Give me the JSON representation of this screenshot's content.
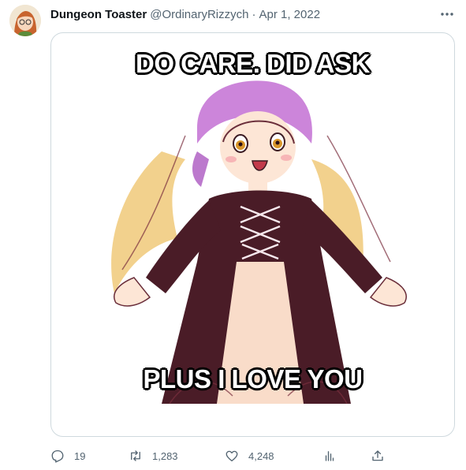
{
  "tweet": {
    "author": {
      "display_name": "Dungeon Toaster",
      "handle": "@OrdinaryRizzych",
      "separator": "·",
      "date": "Apr 1, 2022"
    },
    "media": {
      "caption_top": "DO CARE. DID ASK",
      "caption_bottom": "PLUS I LOVE YOU"
    },
    "actions": {
      "reply_count": "19",
      "retweet_count": "1,283",
      "like_count": "4,248"
    },
    "icons": {
      "more": "more-horizontal-icon",
      "reply": "reply-icon",
      "retweet": "retweet-icon",
      "like": "heart-icon",
      "views": "analytics-icon",
      "share": "share-icon"
    },
    "colors": {
      "text": "#0f1419",
      "secondary": "#536471",
      "border": "#cfd9de"
    }
  }
}
